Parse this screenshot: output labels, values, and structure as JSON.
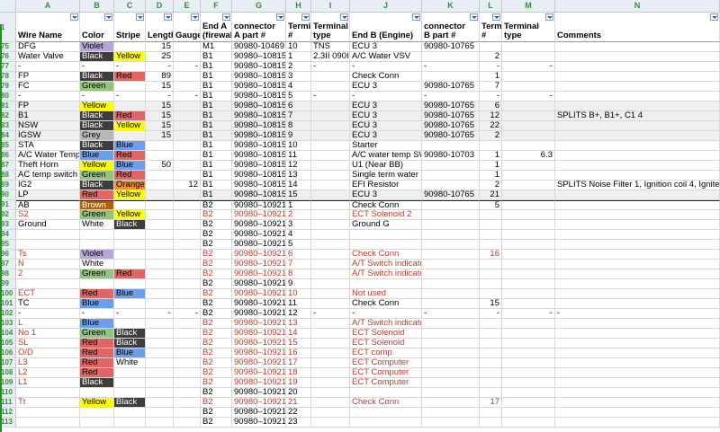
{
  "column_letters": [
    "A",
    "B",
    "C",
    "D",
    "E",
    "F",
    "G",
    "H",
    "I",
    "J",
    "K",
    "L",
    "M",
    "N"
  ],
  "headers": [
    [
      "",
      "Wire Name"
    ],
    [
      "",
      "Color"
    ],
    [
      "",
      "Stripe"
    ],
    [
      "",
      "Length"
    ],
    [
      "",
      "Gauge"
    ],
    [
      "End A",
      "(firewall)"
    ],
    [
      "connector",
      "A part #"
    ],
    [
      "Termi",
      "#"
    ],
    [
      "Terminal",
      "type"
    ],
    [
      "",
      "End B (Engine)"
    ],
    [
      "connector",
      "B part #"
    ],
    [
      "Termi",
      "#"
    ],
    [
      "Terminal",
      "type"
    ],
    [
      "",
      "Comments"
    ]
  ],
  "colors": {
    "violet": "#b4a7d6",
    "black": "#3d3d3d",
    "yellow": "#ffff00",
    "red": "#e06666",
    "green": "#93c47d",
    "grey": "#b7b7b7",
    "blue": "#6d9eeb",
    "orange": "#e69138",
    "brown": "#b45f06",
    "gray_row": "#efefef",
    "row_hdr_text": "#3a8a3a",
    "red_text": "#c0392b"
  },
  "rows": [
    {
      "n": "75",
      "a": "DFG",
      "b": "Violet",
      "c": "",
      "d": "15",
      "e": "",
      "f": "M1",
      "g": "90980-10469",
      "h": "10",
      "i": "TNS",
      "j": "ECU 3",
      "k": "90980-10765",
      "l": "",
      "m": "",
      "nn": "",
      "bg": "violet",
      "cb": "",
      "gray": false,
      "red": false,
      "hv": false
    },
    {
      "n": "76",
      "a": "Water Valve",
      "b": "Black",
      "c": "Yellow",
      "d": "25",
      "e": "",
      "f": "B1",
      "g": "90980–10815",
      "h": "1",
      "i": "2.3II 090II",
      "j": "A/C Water VSV",
      "k": "",
      "l": "2",
      "m": "",
      "nn": "",
      "bg": "black",
      "cb": "yellow",
      "gray": false,
      "red": false,
      "hv": false
    },
    {
      "n": "77",
      "a": "-",
      "b": "-",
      "c": "-",
      "d": "-",
      "e": "-",
      "f": "B1",
      "g": "90980–10815",
      "h": "2",
      "i": "-",
      "j": "-",
      "k": "-",
      "l": "-",
      "m": "-",
      "nn": "",
      "bg": "",
      "cb": "",
      "gray": false,
      "red": false,
      "hv": false
    },
    {
      "n": "78",
      "a": "FP",
      "b": "Black",
      "c": "Red",
      "d": "89",
      "e": "",
      "f": "B1",
      "g": "90980–10815",
      "h": "3",
      "i": "",
      "j": "Check Conn",
      "k": "",
      "l": "1",
      "m": "",
      "nn": "",
      "bg": "black",
      "cb": "red",
      "gray": false,
      "red": false,
      "hv": false
    },
    {
      "n": "79",
      "a": "FC",
      "b": "Green",
      "c": "",
      "d": "15",
      "e": "",
      "f": "B1",
      "g": "90980–10815",
      "h": "4",
      "i": "",
      "j": "ECU 3",
      "k": "90980-10765",
      "l": "7",
      "m": "",
      "nn": "",
      "bg": "green",
      "cb": "",
      "gray": false,
      "red": false,
      "hv": false
    },
    {
      "n": "80",
      "a": "-",
      "b": "-",
      "c": "-",
      "d": "-",
      "e": "-",
      "f": "B1",
      "g": "90980–10815",
      "h": "5",
      "i": "-",
      "j": "-",
      "k": "-",
      "l": "-",
      "m": "-",
      "nn": "",
      "bg": "",
      "cb": "",
      "gray": false,
      "red": false,
      "hv": false
    },
    {
      "n": "81",
      "a": "FP",
      "b": "Yellow",
      "c": "",
      "d": "15",
      "e": "",
      "f": "B1",
      "g": "90980–10815",
      "h": "6",
      "i": "",
      "j": "ECU 3",
      "k": "90980-10765",
      "l": "6",
      "m": "",
      "nn": "",
      "bg": "yellow",
      "cb": "",
      "gray": true,
      "red": false,
      "hv": false
    },
    {
      "n": "82",
      "a": "B1",
      "b": "Black",
      "c": "Red",
      "d": "15",
      "e": "",
      "f": "B1",
      "g": "90980–10815",
      "h": "7",
      "i": "",
      "j": "ECU 3",
      "k": "90980-10765",
      "l": "12",
      "m": "",
      "nn": "SPLITS B+, B1+, C1 4",
      "bg": "black",
      "cb": "red",
      "gray": true,
      "red": false,
      "hv": false
    },
    {
      "n": "83",
      "a": "NSW",
      "b": "Black",
      "c": "Yellow",
      "d": "15",
      "e": "",
      "f": "B1",
      "g": "90980–10815",
      "h": "8",
      "i": "",
      "j": "ECU 3",
      "k": "90980-10765",
      "l": "22",
      "m": "",
      "nn": "",
      "bg": "black",
      "cb": "yellow",
      "gray": true,
      "red": false,
      "hv": false
    },
    {
      "n": "84",
      "a": "IGSW",
      "b": "Grey",
      "c": "",
      "d": "15",
      "e": "",
      "f": "B1",
      "g": "90980–10815",
      "h": "9",
      "i": "",
      "j": "ECU 3",
      "k": "90980-10765",
      "l": "2",
      "m": "",
      "nn": "",
      "bg": "grey",
      "cb": "",
      "gray": true,
      "red": false,
      "hv": false
    },
    {
      "n": "85",
      "a": "STA",
      "b": "Black",
      "c": "Blue",
      "d": "",
      "e": "",
      "f": "B1",
      "g": "90980–10815",
      "h": "10",
      "i": "",
      "j": "Starter",
      "k": "",
      "l": "",
      "m": "",
      "nn": "",
      "bg": "black",
      "cb": "blue",
      "gray": false,
      "red": false,
      "hv": false
    },
    {
      "n": "86",
      "a": "A/C Water Temp",
      "b": "Blue",
      "c": "Red",
      "d": "",
      "e": "",
      "f": "B1",
      "g": "90980–10815",
      "h": "11",
      "i": "",
      "j": "A/C water temp SW",
      "k": "90980-10703",
      "l": "1",
      "m": "6.3",
      "nn": "",
      "bg": "blue",
      "cb": "red",
      "gray": false,
      "red": false,
      "hv": false
    },
    {
      "n": "87",
      "a": "Theft Horn",
      "b": "Yellow",
      "c": "Blue",
      "d": "50",
      "e": "",
      "f": "B1",
      "g": "90980–10815",
      "h": "12",
      "i": "",
      "j": "U1 (Near BB)",
      "k": "",
      "l": "1",
      "m": "",
      "nn": "",
      "bg": "yellow",
      "cb": "blue",
      "gray": false,
      "red": false,
      "hv": false
    },
    {
      "n": "88",
      "a": "AC temp switch",
      "b": "Green",
      "c": "Red",
      "d": "",
      "e": "",
      "f": "B1",
      "g": "90980–10815",
      "h": "13",
      "i": "",
      "j": "Single term water",
      "k": "",
      "l": "1",
      "m": "",
      "nn": "",
      "bg": "green",
      "cb": "red",
      "gray": false,
      "red": false,
      "hv": false
    },
    {
      "n": "89",
      "a": "IG2",
      "b": "Black",
      "c": "Orange",
      "d": "",
      "e": "12",
      "f": "B1",
      "g": "90980–10815",
      "h": "14",
      "i": "",
      "j": "EFI Resistor",
      "k": "",
      "l": "2",
      "m": "",
      "nn": "SPLITS Noise Filter 1, Ignition coil 4, Igniter 3",
      "bg": "black",
      "cb": "orange",
      "gray": false,
      "red": false,
      "hv": false
    },
    {
      "n": "90",
      "a": "LP",
      "b": "Red",
      "c": "Yellow",
      "d": "",
      "e": "",
      "f": "B1",
      "g": "90980–10815",
      "h": "15",
      "i": "",
      "j": "ECU 3",
      "k": "90980-10765",
      "l": "21",
      "m": "",
      "nn": "",
      "bg": "red",
      "cb": "yellow",
      "gray": true,
      "red": false,
      "hv": false
    },
    {
      "n": "91",
      "a": "AB",
      "b": "Brown",
      "c": "",
      "d": "",
      "e": "",
      "f": "B2",
      "g": "90980–10921",
      "h": "1",
      "i": "",
      "j": "Check Conn",
      "k": "",
      "l": "5",
      "m": "",
      "nn": "",
      "bg": "brown",
      "cb": "",
      "gray": false,
      "red": false,
      "hv": true
    },
    {
      "n": "92",
      "a": "S2",
      "b": "Green",
      "c": "Yellow",
      "d": "",
      "e": "",
      "f": "B2",
      "g": "90980–10921",
      "h": "2",
      "i": "",
      "j": "ECT Solenoid 2",
      "k": "",
      "l": "",
      "m": "",
      "nn": "",
      "bg": "green",
      "cb": "yellow",
      "gray": false,
      "red": true,
      "hv": false
    },
    {
      "n": "93",
      "a": "Ground",
      "b": "White",
      "c": "Black",
      "d": "",
      "e": "",
      "f": "B2",
      "g": "90980–10921",
      "h": "3",
      "i": "",
      "j": "Ground G",
      "k": "",
      "l": "",
      "m": "",
      "nn": "",
      "bg": "",
      "cb": "black",
      "gray": false,
      "red": false,
      "hv": false
    },
    {
      "n": "94",
      "a": "",
      "b": "",
      "c": "",
      "d": "",
      "e": "",
      "f": "B2",
      "g": "90980–10921",
      "h": "4",
      "i": "",
      "j": "",
      "k": "",
      "l": "",
      "m": "",
      "nn": "",
      "bg": "",
      "cb": "",
      "gray": false,
      "red": false,
      "hv": false
    },
    {
      "n": "95",
      "a": "",
      "b": "",
      "c": "",
      "d": "",
      "e": "",
      "f": "B2",
      "g": "90980–10921",
      "h": "5",
      "i": "",
      "j": "",
      "k": "",
      "l": "",
      "m": "",
      "nn": "",
      "bg": "",
      "cb": "",
      "gray": false,
      "red": false,
      "hv": false
    },
    {
      "n": "96",
      "a": "Ts",
      "b": "Violet",
      "c": "",
      "d": "",
      "e": "",
      "f": "B2",
      "g": "90980–10921",
      "h": "6",
      "i": "",
      "j": "Check Conn",
      "k": "",
      "l": "16",
      "m": "",
      "nn": "",
      "bg": "violet",
      "cb": "",
      "gray": false,
      "red": true,
      "hv": false
    },
    {
      "n": "97",
      "a": "N",
      "b": "White",
      "c": "",
      "d": "",
      "e": "",
      "f": "B2",
      "g": "90980–10921",
      "h": "7",
      "i": "",
      "j": "A/T Switch indicator",
      "k": "",
      "l": "",
      "m": "",
      "nn": "",
      "bg": "",
      "cb": "",
      "gray": false,
      "red": true,
      "hv": false
    },
    {
      "n": "98",
      "a": "2",
      "b": "Green",
      "c": "Red",
      "d": "",
      "e": "",
      "f": "B2",
      "g": "90980–10921",
      "h": "8",
      "i": "",
      "j": "A/T Switch indicator",
      "k": "",
      "l": "",
      "m": "",
      "nn": "",
      "bg": "green",
      "cb": "red",
      "gray": false,
      "red": true,
      "hv": false
    },
    {
      "n": "99",
      "a": "",
      "b": "",
      "c": "",
      "d": "",
      "e": "",
      "f": "B2",
      "g": "90980–10921",
      "h": "9",
      "i": "",
      "j": "",
      "k": "",
      "l": "",
      "m": "",
      "nn": "",
      "bg": "",
      "cb": "",
      "gray": false,
      "red": false,
      "hv": false
    },
    {
      "n": "100",
      "a": "ECT",
      "b": "Red",
      "c": "Blue",
      "d": "",
      "e": "",
      "f": "B2",
      "g": "90980–10921",
      "h": "10",
      "i": "",
      "j": "Not used",
      "k": "",
      "l": "",
      "m": "",
      "nn": "",
      "bg": "red",
      "cb": "blue",
      "gray": false,
      "red": true,
      "hv": false
    },
    {
      "n": "101",
      "a": "TC",
      "b": "Blue",
      "c": "",
      "d": "",
      "e": "",
      "f": "B2",
      "g": "90980–10921",
      "h": "11",
      "i": "",
      "j": "Check Conn",
      "k": "",
      "l": "15",
      "m": "",
      "nn": "",
      "bg": "blue",
      "cb": "",
      "gray": false,
      "red": false,
      "hv": false
    },
    {
      "n": "102",
      "a": "-",
      "b": "-",
      "c": "-",
      "d": "-",
      "e": "-",
      "f": "B2",
      "g": "90980–10921",
      "h": "12",
      "i": "-",
      "j": "-",
      "k": "-",
      "l": "-",
      "m": "-",
      "nn": "-",
      "bg": "",
      "cb": "",
      "gray": false,
      "red": false,
      "hv": false
    },
    {
      "n": "103",
      "a": "L",
      "b": "Blue",
      "c": "",
      "d": "",
      "e": "",
      "f": "B2",
      "g": "90980–10921",
      "h": "13",
      "i": "",
      "j": "A/T Switch indicator",
      "k": "",
      "l": "",
      "m": "",
      "nn": "",
      "bg": "blue",
      "cb": "",
      "gray": false,
      "red": true,
      "hv": false
    },
    {
      "n": "104",
      "a": "No 1",
      "b": "Green",
      "c": "Black",
      "d": "",
      "e": "",
      "f": "B2",
      "g": "90980–10921",
      "h": "14",
      "i": "",
      "j": "ECT Solenoid",
      "k": "",
      "l": "",
      "m": "",
      "nn": "",
      "bg": "green",
      "cb": "black",
      "gray": false,
      "red": true,
      "hv": false
    },
    {
      "n": "105",
      "a": "SL",
      "b": "Red",
      "c": "Black",
      "d": "",
      "e": "",
      "f": "B2",
      "g": "90980–10921",
      "h": "15",
      "i": "",
      "j": "ECT Solenoid",
      "k": "",
      "l": "",
      "m": "",
      "nn": "",
      "bg": "red",
      "cb": "black",
      "gray": false,
      "red": true,
      "hv": false
    },
    {
      "n": "106",
      "a": "O/D",
      "b": "Red",
      "c": "Blue",
      "d": "",
      "e": "",
      "f": "B2",
      "g": "90980–10921",
      "h": "16",
      "i": "",
      "j": "ECT comp",
      "k": "",
      "l": "",
      "m": "",
      "nn": "",
      "bg": "red",
      "cb": "blue",
      "gray": false,
      "red": true,
      "hv": false
    },
    {
      "n": "107",
      "a": "L3",
      "b": "Red",
      "c": "White",
      "d": "",
      "e": "",
      "f": "B2",
      "g": "90980–10921",
      "h": "17",
      "i": "",
      "j": "ECT Computer",
      "k": "",
      "l": "",
      "m": "",
      "nn": "",
      "bg": "red",
      "cb": "",
      "gray": false,
      "red": true,
      "hv": false
    },
    {
      "n": "108",
      "a": "L2",
      "b": "Red",
      "c": "",
      "d": "",
      "e": "",
      "f": "B2",
      "g": "90980–10921",
      "h": "18",
      "i": "",
      "j": "ECT Computer",
      "k": "",
      "l": "",
      "m": "",
      "nn": "",
      "bg": "red",
      "cb": "",
      "gray": false,
      "red": true,
      "hv": false
    },
    {
      "n": "109",
      "a": "L1",
      "b": "Black",
      "c": "",
      "d": "",
      "e": "",
      "f": "B2",
      "g": "90980–10921",
      "h": "19",
      "i": "",
      "j": "ECT Computer",
      "k": "",
      "l": "",
      "m": "",
      "nn": "",
      "bg": "black",
      "cb": "",
      "gray": false,
      "red": true,
      "hv": false
    },
    {
      "n": "110",
      "a": "",
      "b": "",
      "c": "",
      "d": "",
      "e": "",
      "f": "B2",
      "g": "90980–10921",
      "h": "20",
      "i": "",
      "j": "",
      "k": "",
      "l": "",
      "m": "",
      "nn": "",
      "bg": "",
      "cb": "",
      "gray": false,
      "red": false,
      "hv": false
    },
    {
      "n": "111",
      "a": "Tt",
      "b": "Yellow",
      "c": "Black",
      "d": "",
      "e": "",
      "f": "B2",
      "g": "90980–10921",
      "h": "21",
      "i": "",
      "j": "Check Conn",
      "k": "",
      "l": "17",
      "m": "",
      "nn": "",
      "bg": "yellow",
      "cb": "black",
      "gray": false,
      "red": true,
      "hv": false
    },
    {
      "n": "112",
      "a": "",
      "b": "",
      "c": "",
      "d": "",
      "e": "",
      "f": "B2",
      "g": "90980–10921",
      "h": "22",
      "i": "",
      "j": "",
      "k": "",
      "l": "",
      "m": "",
      "nn": "",
      "bg": "",
      "cb": "",
      "gray": false,
      "red": false,
      "hv": false
    },
    {
      "n": "113",
      "a": "",
      "b": "",
      "c": "",
      "d": "",
      "e": "",
      "f": "B2",
      "g": "90980–10921",
      "h": "23",
      "i": "",
      "j": "",
      "k": "",
      "l": "",
      "m": "",
      "nn": "",
      "bg": "",
      "cb": "",
      "gray": false,
      "red": false,
      "hv": false
    }
  ]
}
